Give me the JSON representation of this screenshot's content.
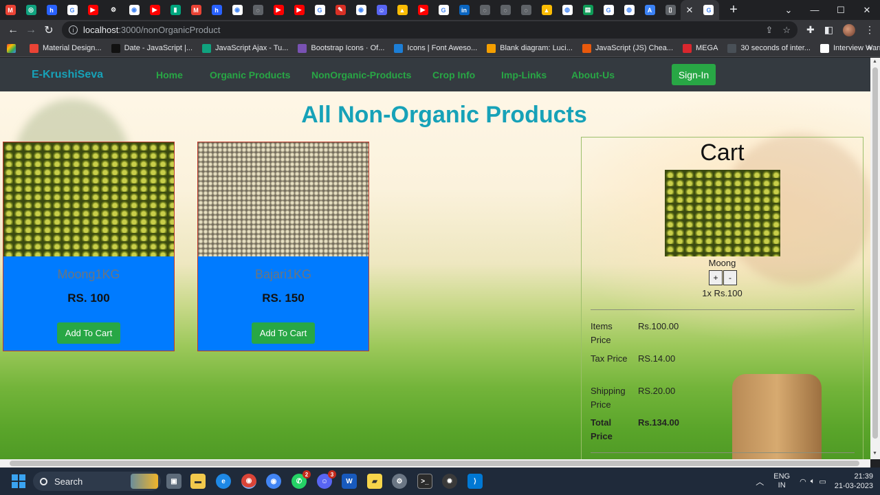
{
  "browser": {
    "url_host": "localhost",
    "url_path": ":3000/nonOrganicProduct",
    "tabs": [
      {
        "icon": "gmail-icon",
        "color": "#ea4335",
        "glyph": "M"
      },
      {
        "icon": "chatgpt-icon",
        "color": "#10a37f",
        "glyph": "◎"
      },
      {
        "icon": "hashnode-icon",
        "color": "#2962ff",
        "glyph": "h"
      },
      {
        "icon": "google-icon",
        "color": "#ffffff",
        "glyph": "G"
      },
      {
        "icon": "youtube-icon",
        "color": "#ff0000",
        "glyph": "▶"
      },
      {
        "icon": "settings-icon",
        "color": "#202124",
        "glyph": "⚙"
      },
      {
        "icon": "chrome-icon",
        "color": "#ffffff",
        "glyph": "◉"
      },
      {
        "icon": "youtube-icon",
        "color": "#ff0000",
        "glyph": "▶"
      },
      {
        "icon": "stat-icon",
        "color": "#00a67e",
        "glyph": "▮"
      },
      {
        "icon": "gmail-icon",
        "color": "#ea4335",
        "glyph": "M"
      },
      {
        "icon": "hashnode-icon",
        "color": "#2962ff",
        "glyph": "h"
      },
      {
        "icon": "chrome-icon",
        "color": "#ffffff",
        "glyph": "◉"
      },
      {
        "icon": "globe-icon",
        "color": "#5f6368",
        "glyph": "◌"
      },
      {
        "icon": "youtube-icon",
        "color": "#ff0000",
        "glyph": "▶"
      },
      {
        "icon": "youtube-icon",
        "color": "#ff0000",
        "glyph": "▶"
      },
      {
        "icon": "google-icon",
        "color": "#ffffff",
        "glyph": "G"
      },
      {
        "icon": "feather-icon",
        "color": "#d93025",
        "glyph": "✎"
      },
      {
        "icon": "chrome-icon",
        "color": "#ffffff",
        "glyph": "◉"
      },
      {
        "icon": "discord-icon",
        "color": "#5865f2",
        "glyph": "☺"
      },
      {
        "icon": "drive-icon",
        "color": "#fbbc04",
        "glyph": "▲"
      },
      {
        "icon": "youtube-icon",
        "color": "#ff0000",
        "glyph": "▶"
      },
      {
        "icon": "google-icon",
        "color": "#ffffff",
        "glyph": "G"
      },
      {
        "icon": "linkedin-icon",
        "color": "#0a66c2",
        "glyph": "in"
      },
      {
        "icon": "globe-icon",
        "color": "#5f6368",
        "glyph": "◌"
      },
      {
        "icon": "globe-icon",
        "color": "#5f6368",
        "glyph": "◌"
      },
      {
        "icon": "globe-icon",
        "color": "#5f6368",
        "glyph": "◌"
      },
      {
        "icon": "drive-icon",
        "color": "#fbbc04",
        "glyph": "▲"
      },
      {
        "icon": "github-icon",
        "color": "#ffffff",
        "glyph": "◍"
      },
      {
        "icon": "sheets-icon",
        "color": "#0f9d58",
        "glyph": "▤"
      },
      {
        "icon": "google-icon",
        "color": "#ffffff",
        "glyph": "G"
      },
      {
        "icon": "github-icon",
        "color": "#ffffff",
        "glyph": "◍"
      },
      {
        "icon": "aws-icon",
        "color": "#3b82f6",
        "glyph": "A"
      },
      {
        "icon": "doc-icon",
        "color": "#5f6368",
        "glyph": "▯"
      }
    ],
    "bookmarks": [
      {
        "label": "Material Design...",
        "icon": "material-icon",
        "color": "#ea4335"
      },
      {
        "label": "Date - JavaScript |...",
        "icon": "mdn-icon",
        "color": "#111111"
      },
      {
        "label": "JavaScript Ajax - Tu...",
        "icon": "tutorial-icon",
        "color": "#10a37f"
      },
      {
        "label": "Bootstrap Icons · Of...",
        "icon": "bootstrap-icon",
        "color": "#7952b3"
      },
      {
        "label": "Icons | Font Aweso...",
        "icon": "flag-icon",
        "color": "#1c7ed6"
      },
      {
        "label": "Blank diagram: Luci...",
        "icon": "lucid-icon",
        "color": "#f59f00"
      },
      {
        "label": "JavaScript (JS) Chea...",
        "icon": "cheatsheet-icon",
        "color": "#e8590c"
      },
      {
        "label": "MEGA",
        "icon": "mega-icon",
        "color": "#d9272e"
      },
      {
        "label": "30 seconds of inter...",
        "icon": "thirty-icon",
        "color": "#495057"
      },
      {
        "label": "Interview Warmup - ...",
        "icon": "warmup-icon",
        "color": "#ffffff"
      }
    ]
  },
  "nav": {
    "brand": "E-KrushiSeva",
    "links": [
      "Home",
      "Organic Products",
      "NonOrganic-Products",
      "Crop Info",
      "Imp-Links",
      "About-Us"
    ],
    "signin": "Sign-In"
  },
  "page": {
    "title": "All Non-Organic Products"
  },
  "products": [
    {
      "name": "Moong1KG",
      "price": "RS. 100",
      "button": "Add To Cart",
      "image": "moong"
    },
    {
      "name": "Bajari1KG",
      "price": "RS. 150",
      "button": "Add To Cart",
      "image": "bajari"
    }
  ],
  "cart": {
    "title": "Cart",
    "item_name": "Moong",
    "plus": "+",
    "minus": "-",
    "item_line": "1x Rs.100",
    "rows": [
      {
        "label": "Items Price",
        "value": "Rs.100.00"
      },
      {
        "label": "Tax Price",
        "value": "RS.14.00"
      },
      {
        "label": "Shipping Price",
        "value": "RS.20.00"
      },
      {
        "label": "Total Price",
        "value": "Rs.134.00"
      }
    ]
  },
  "taskbar": {
    "search": "Search",
    "lang_line1": "ENG",
    "lang_line2": "IN",
    "time": "21:39",
    "date": "21-03-2023",
    "discord_badge": "2",
    "discord2_badge": "3"
  }
}
